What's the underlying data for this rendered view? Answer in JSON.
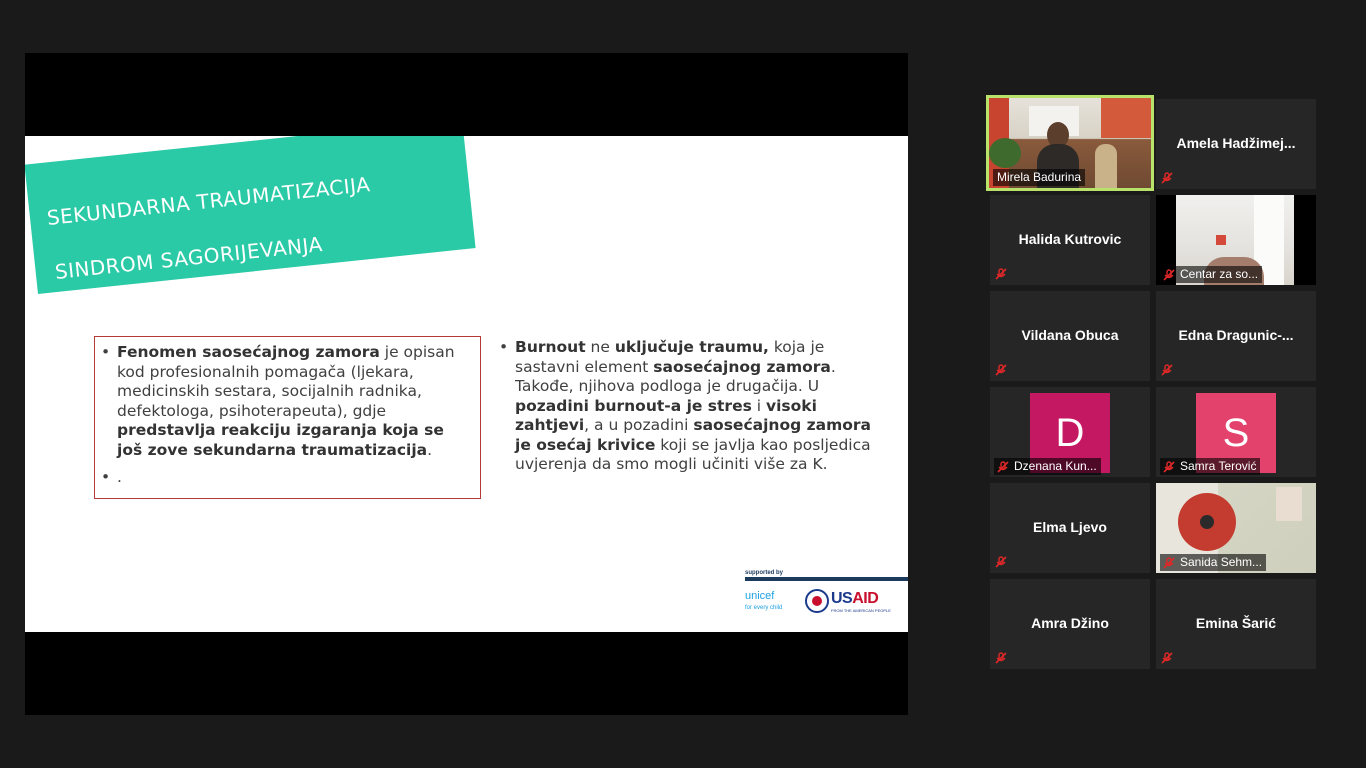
{
  "slide": {
    "banner_line1": "SEKUNDARNA TRAUMATIZACIJA",
    "banner_line2": "SINDROM SAGORIJEVANJA",
    "left_bullets": [
      {
        "b1": "Fenomen saosećajnog zamora",
        "t1": " je opisan kod profesionalnih pomagača (ljekara, medicinskih sestara, socijalnih radnika, defektologa, psihoterapeuta), gdje ",
        "b2": "predstavlja reakciju izgaranja koja se još zove sekundarna traumatizacija",
        "t2": "."
      },
      {
        "text": "."
      }
    ],
    "right_bullet": {
      "b1": "Burnout",
      "t1": " ne ",
      "b2": "uključuje traumu,",
      "t2": " koja je sastavni element ",
      "b3": "saosećajnog zamora",
      "t3": ". Takođe, njihova podloga je drugačija. U ",
      "b4": "pozadini burnout-a je stres",
      "t4": " i ",
      "b5": "visoki zahtjevi",
      "t5": ", a u pozadini ",
      "b6": "saosećajnog zamora je osećaj krivice",
      "t6": " koji se javlja kao posljedica uvjerenja da smo mogli učiniti više za K."
    },
    "logos": {
      "supported": "supported by",
      "unicef": "unicef",
      "unicef_sub": "for every child",
      "usaid_us": "US",
      "usaid_aid": "AID",
      "usaid_sub": "FROM THE AMERICAN PEOPLE"
    }
  },
  "participants": [
    {
      "name": "Mirela Badurina",
      "type": "video",
      "active": true
    },
    {
      "name": "Amela  Hadžimej...",
      "type": "name"
    },
    {
      "name": "Halida Kutrovic",
      "type": "name"
    },
    {
      "name": "Centar za so...",
      "type": "video"
    },
    {
      "name": "Vildana Obuca",
      "type": "name"
    },
    {
      "name": "Edna  Dragunic-...",
      "type": "name"
    },
    {
      "name": "Dzenana Kun...",
      "type": "avatar",
      "initial": "D",
      "color": "#c41862"
    },
    {
      "name": "Samra Terović",
      "type": "avatar",
      "initial": "S",
      "color": "#e3426d"
    },
    {
      "name": "Elma Ljevo",
      "type": "name"
    },
    {
      "name": "Sanida Sehm...",
      "type": "video"
    },
    {
      "name": "Amra Džino",
      "type": "name"
    },
    {
      "name": "Emina Šarić",
      "type": "name"
    }
  ],
  "colors": {
    "banner": "#2bcaa6",
    "active_speaker_border": "#b9e26b",
    "mute_icon": "#e02828"
  }
}
